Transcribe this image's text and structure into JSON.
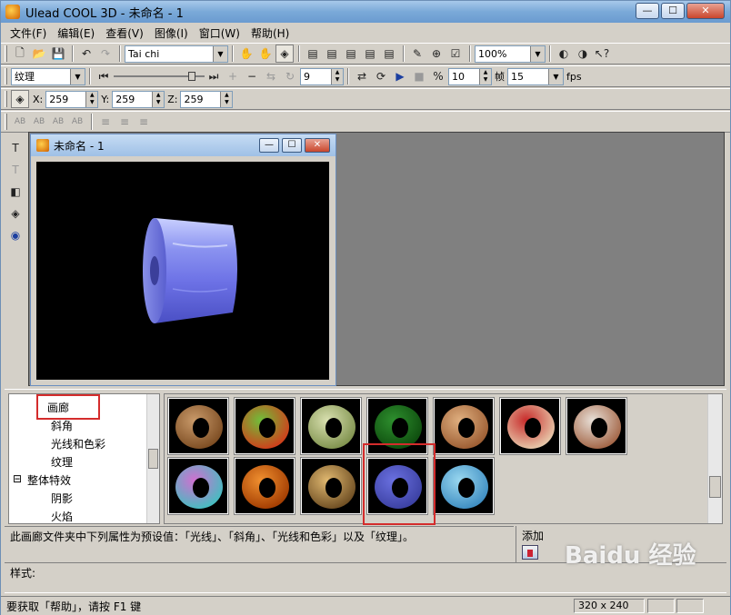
{
  "window": {
    "title": "Ulead COOL 3D - 未命名 - 1",
    "min": "—",
    "max": "☐",
    "close": "✕"
  },
  "menu": [
    "文件(F)",
    "编辑(E)",
    "查看(V)",
    "图像(I)",
    "窗口(W)",
    "帮助(H)"
  ],
  "toolbar1": {
    "font": "Tai chi",
    "zoom": "100%"
  },
  "toolbar2": {
    "attribute": "纹理",
    "frame": "9",
    "frames_total": "10",
    "fps_value": "15",
    "fps_label": "fps",
    "frame_label": "帧"
  },
  "toolbar3": {
    "x_label": "X:",
    "x_value": "259",
    "y_label": "Y:",
    "y_value": "259",
    "z_label": "Z:",
    "z_value": "259"
  },
  "toolbar4": {
    "icons": [
      "AB",
      "AB",
      "AB",
      "AB"
    ]
  },
  "document": {
    "title": "未命名 - 1"
  },
  "tree": {
    "items": [
      "画廊",
      "斜角",
      "光线和色彩",
      "纹理",
      "整体特效",
      "阴影",
      "火焰"
    ],
    "expander": "⊟"
  },
  "description": "此画廊文件夹中下列属性为预设值：「光线」、「斜角」、「光线和色彩」以及「纹理」。",
  "add_label": "添加",
  "style_label": "样式:",
  "status": {
    "help": "要获取「帮助」，请按 F1 键",
    "size": "320 x 240"
  },
  "watermark": "Baidu 经验",
  "colors": {
    "selection": "#d42c2c",
    "canvas": "#000000",
    "titlebar": "#7aa9d8"
  }
}
